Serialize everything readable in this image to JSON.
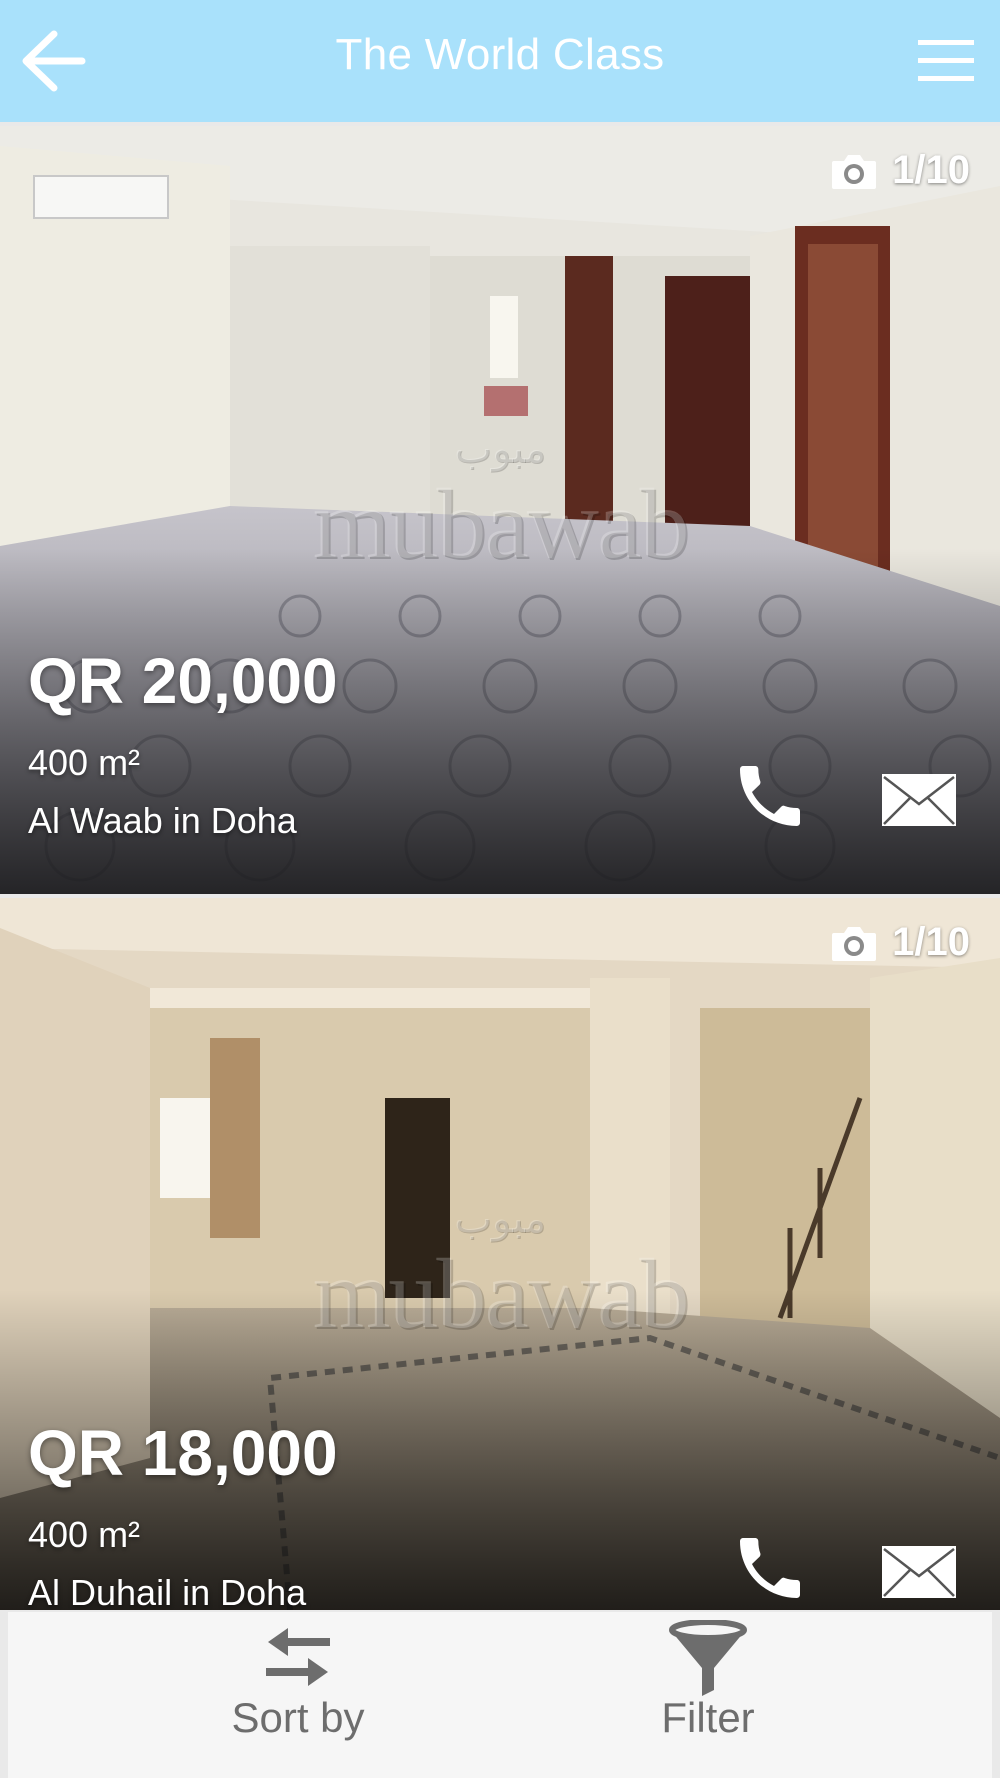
{
  "header": {
    "title": "The World Class",
    "background": "#a9e1fb",
    "back_icon": "arrow-left-icon",
    "menu_icon": "hamburger-menu-icon"
  },
  "listings": [
    {
      "photo_counter": "1/10",
      "watermark": "mubawab",
      "watermark_ar": "مبوب",
      "price": "QR 20,000",
      "area": "400 m²",
      "location": "Al Waab in Doha",
      "call_icon": "phone-icon",
      "mail_icon": "envelope-icon"
    },
    {
      "photo_counter": "1/10",
      "watermark": "mubawab",
      "watermark_ar": "مبوب",
      "price": "QR 18,000",
      "area": "400 m²",
      "location": "Al Duhail in Doha",
      "call_icon": "phone-icon",
      "mail_icon": "envelope-icon"
    }
  ],
  "bottom_bar": {
    "sort_label": "Sort by",
    "sort_icon": "swap-arrows-icon",
    "filter_label": "Filter",
    "filter_icon": "funnel-icon",
    "label_color": "#6d6d6d"
  }
}
